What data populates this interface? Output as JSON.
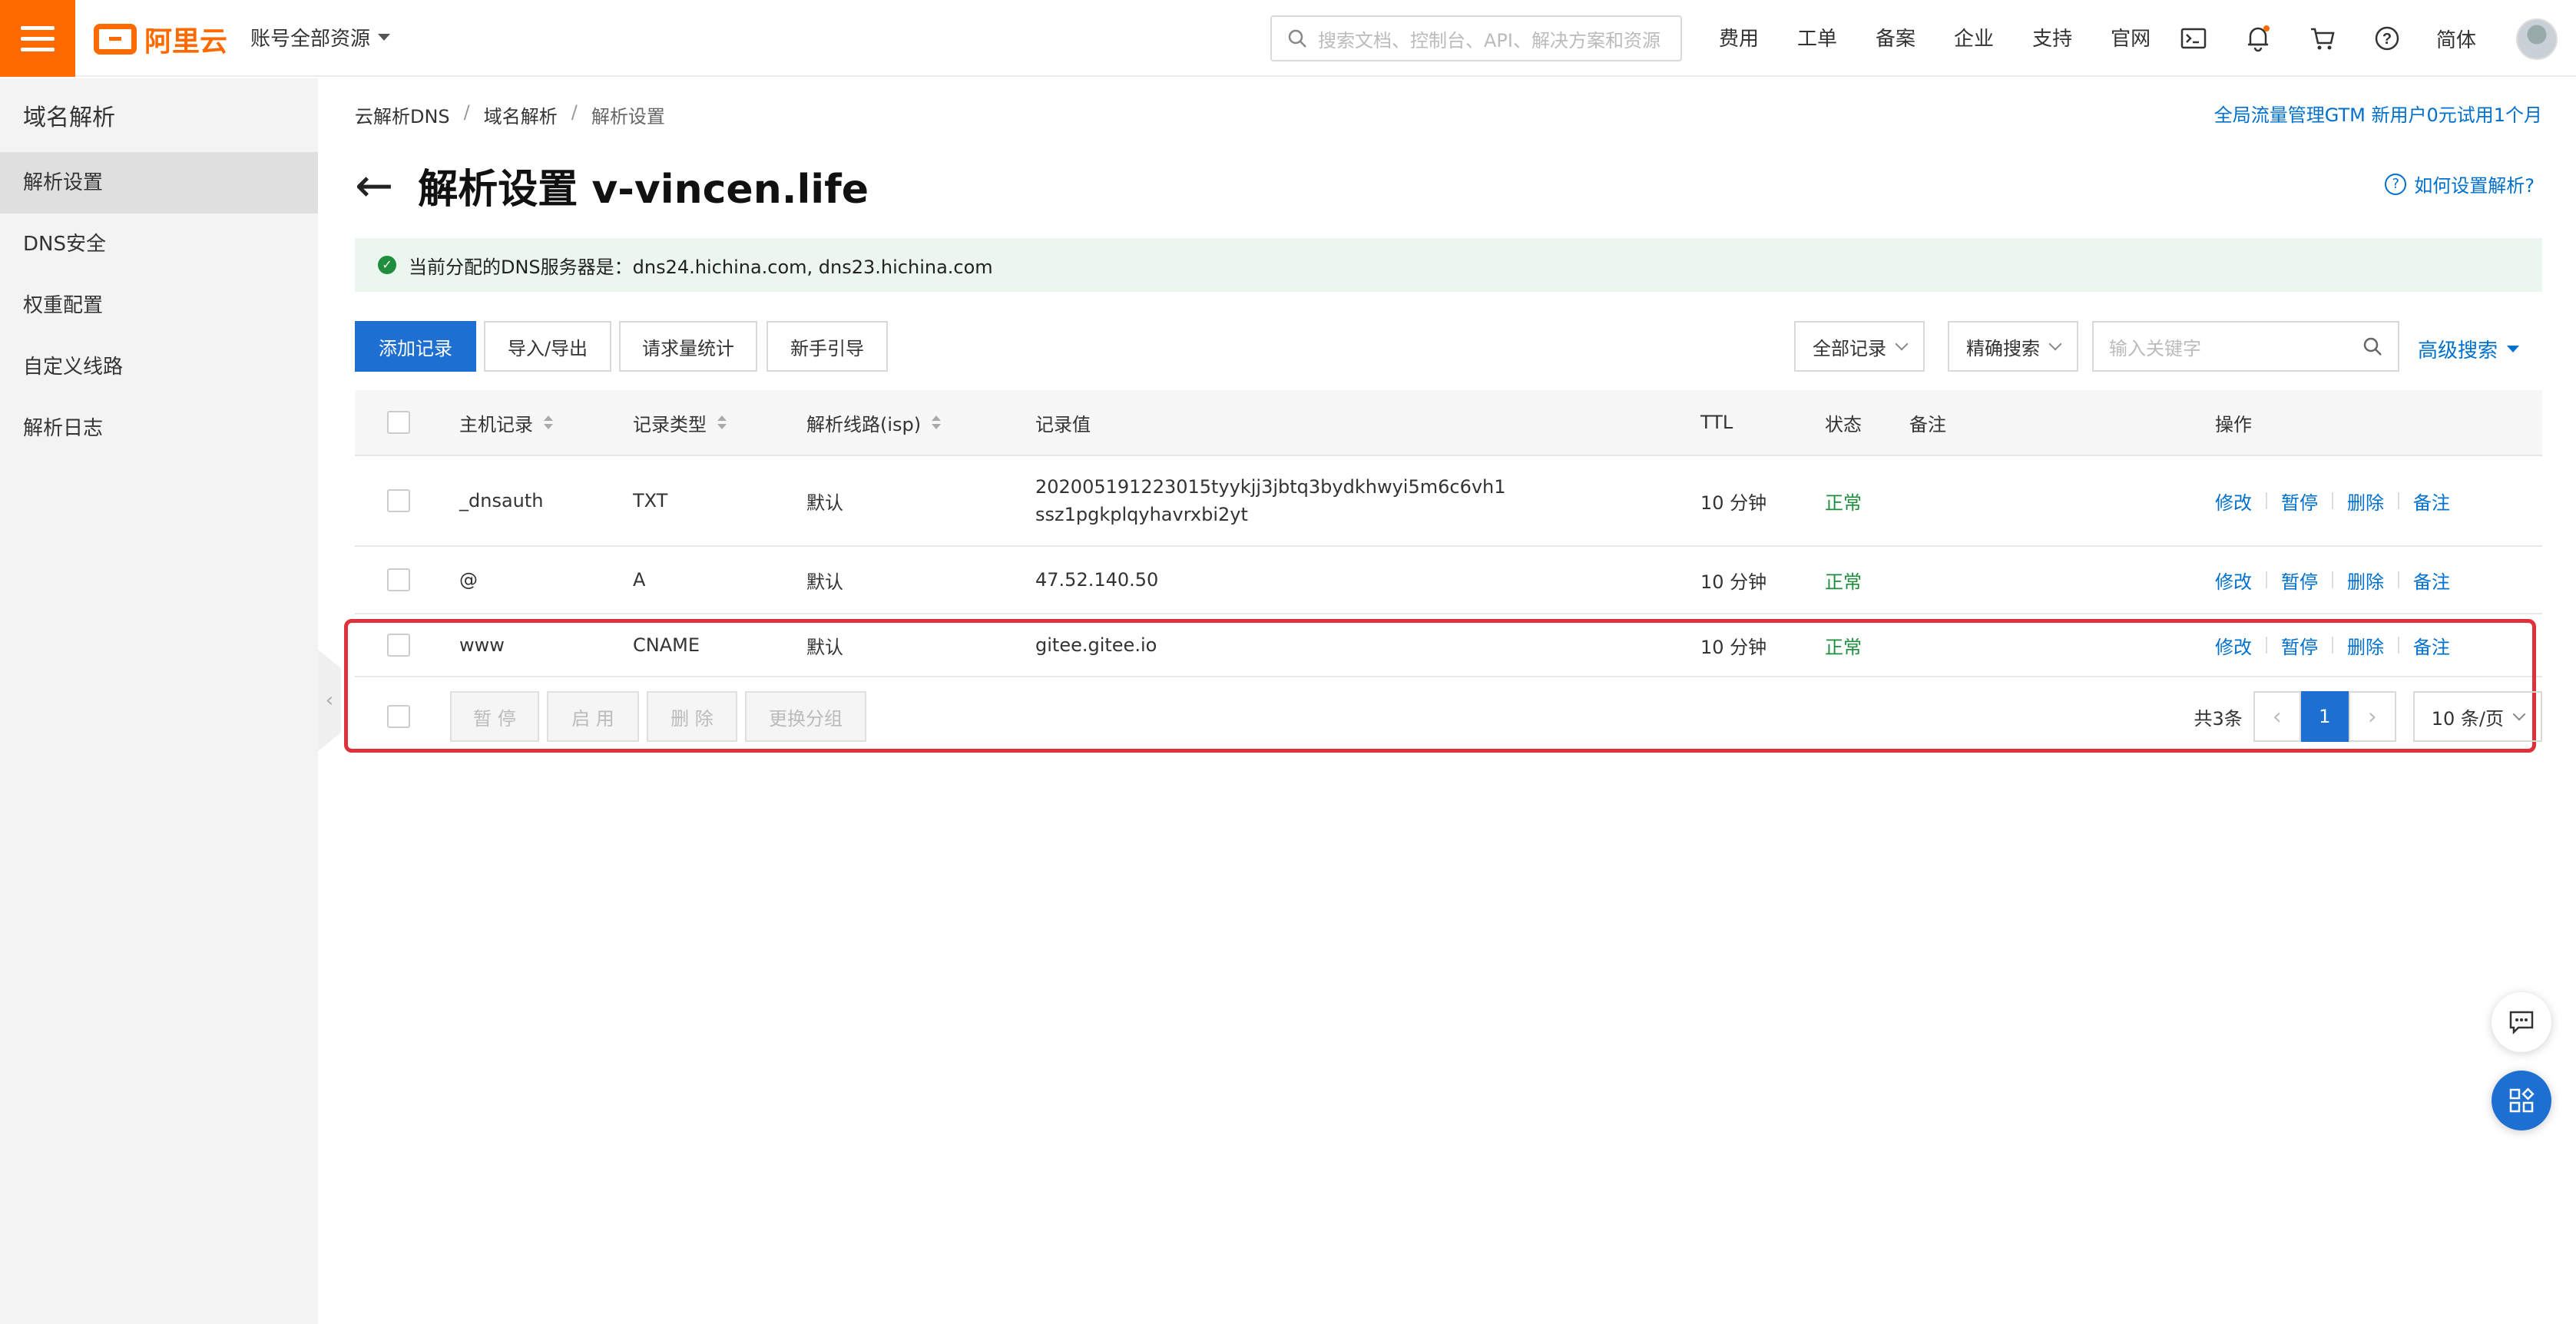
{
  "header": {
    "logo_text": "阿里云",
    "account_scope": "账号全部资源",
    "search_placeholder": "搜索文档、控制台、API、解决方案和资源",
    "nav": [
      "费用",
      "工单",
      "备案",
      "企业",
      "支持",
      "官网"
    ],
    "lang": "简体",
    "icons": [
      "terminal-icon",
      "bell-icon",
      "cart-icon",
      "help-icon"
    ]
  },
  "sidebar": {
    "title": "域名解析",
    "items": [
      {
        "label": "解析设置",
        "active": true
      },
      {
        "label": "DNS安全",
        "active": false
      },
      {
        "label": "权重配置",
        "active": false
      },
      {
        "label": "自定义线路",
        "active": false
      },
      {
        "label": "解析日志",
        "active": false
      }
    ]
  },
  "breadcrumb": [
    "云解析DNS",
    "域名解析",
    "解析设置"
  ],
  "promo": "全局流量管理GTM 新用户0元试用1个月",
  "page_title": "解析设置 v-vincen.life",
  "help_link": "如何设置解析?",
  "notice": "当前分配的DNS服务器是：dns24.hichina.com, dns23.hichina.com",
  "toolbar": {
    "add": "添加记录",
    "import_export": "导入/导出",
    "stats": "请求量统计",
    "guide": "新手引导",
    "filter_all": "全部记录",
    "filter_mode": "精确搜索",
    "keyword_placeholder": "输入关键字",
    "advanced": "高级搜索"
  },
  "table": {
    "headers": {
      "host": "主机记录",
      "type": "记录类型",
      "line": "解析线路(isp)",
      "value": "记录值",
      "ttl": "TTL",
      "status": "状态",
      "remark": "备注",
      "ops": "操作"
    },
    "rows": [
      {
        "host": "_dnsauth",
        "type": "TXT",
        "line": "默认",
        "value_line1": "202005191223015tyykjj3jbtq3bydkhwyi5m6c6vh1",
        "value_line2": "ssz1pgkplqyhavrxbi2yt",
        "ttl": "10 分钟",
        "status": "正常"
      },
      {
        "host": "@",
        "type": "A",
        "line": "默认",
        "value_line1": "47.52.140.50",
        "value_line2": "",
        "ttl": "10 分钟",
        "status": "正常"
      },
      {
        "host": "www",
        "type": "CNAME",
        "line": "默认",
        "value_line1": "gitee.gitee.io",
        "value_line2": "",
        "ttl": "10 分钟",
        "status": "正常"
      }
    ],
    "ops": [
      "修改",
      "暂停",
      "删除",
      "备注"
    ]
  },
  "footer": {
    "batch": [
      "暂 停",
      "启 用",
      "删 除",
      "更换分组"
    ],
    "total": "共3条",
    "current_page": "1",
    "page_size": "10 条/页"
  },
  "colors": {
    "brand": "#ff6a00",
    "primary": "#1d6fd1",
    "link": "#0070cc",
    "ok": "#1e8e3e",
    "highlight": "#e0303a"
  }
}
